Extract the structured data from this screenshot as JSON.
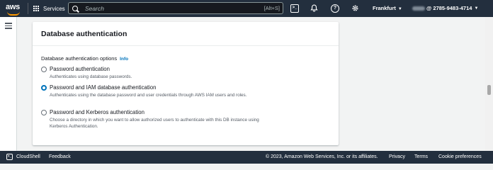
{
  "topbar": {
    "logo_text": "aws",
    "services_label": "Services",
    "search_placeholder": "Search",
    "search_shortcut": "[Alt+S]",
    "region": "Frankfurt",
    "account_id": "@ 2785-9483-4714"
  },
  "icons": {
    "cloudshell": "terminal-icon",
    "notifications": "bell-icon",
    "help": "help-icon",
    "settings": "gear-icon"
  },
  "panel": {
    "title": "Database authentication",
    "options_label": "Database authentication options",
    "info_label": "Info",
    "options": [
      {
        "title": "Password authentication",
        "description": "Authenticates using database passwords.",
        "selected": false
      },
      {
        "title": "Password and IAM database authentication",
        "description": "Authenticates using the database password and user credentials through AWS IAM users and roles.",
        "selected": true
      },
      {
        "title": "Password and Kerberos authentication",
        "description": "Choose a directory in which you want to allow authorized users to authenticate with this DB instance using Kerberos Authentication.",
        "selected": false
      }
    ]
  },
  "footer": {
    "cloudshell_label": "CloudShell",
    "feedback_label": "Feedback",
    "copyright": "© 2023, Amazon Web Services, Inc. or its affiliates.",
    "privacy_label": "Privacy",
    "terms_label": "Terms",
    "cookie_label": "Cookie preferences"
  },
  "colors": {
    "nav_bg": "#232f3e",
    "accent": "#0073bb",
    "logo_smile": "#ff9900"
  }
}
